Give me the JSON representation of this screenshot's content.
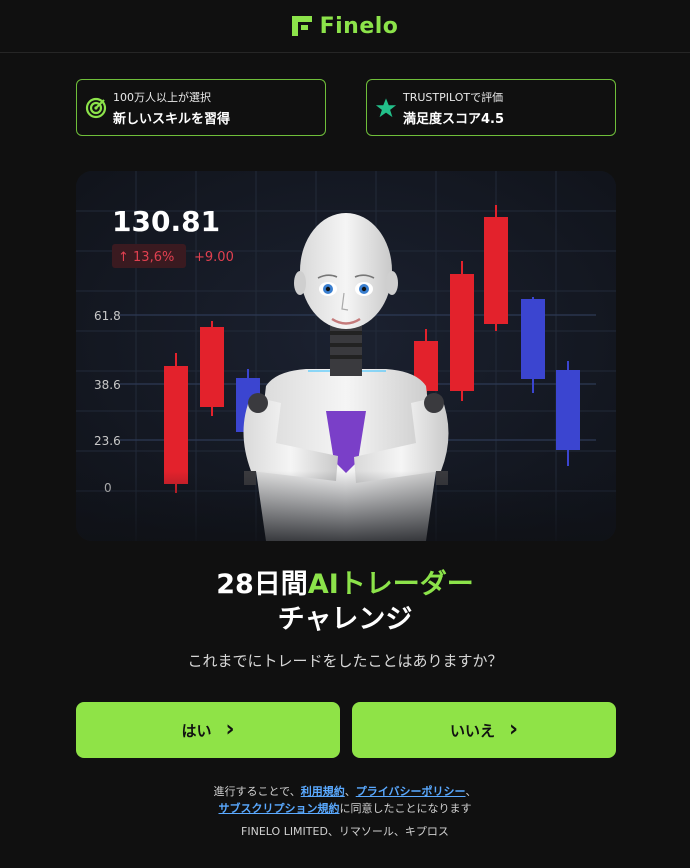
{
  "brand": {
    "name": "Finelo",
    "color": "#8ce34a"
  },
  "badges": [
    {
      "icon": "target-icon",
      "small": "100万人以上が選択",
      "big": "新しいスキルを習得"
    },
    {
      "icon": "star-icon",
      "small": "TRUSTPILOTで評価",
      "big": "満足度スコア4.5"
    }
  ],
  "hero": {
    "price": "130.81",
    "change_pct": "↑ 13,6%",
    "change_abs": "+9.00",
    "y_ticks": [
      "61.8",
      "38.6",
      "23.6",
      "0"
    ]
  },
  "title": {
    "line1_plain": "28日間",
    "line1_accent": "AIトレーダー",
    "line2": "チャレンジ"
  },
  "question": "これまでにトレードをしたことはありますか？",
  "buttons": {
    "yes": "はい",
    "no": "いいえ",
    "chevron": "›"
  },
  "legal": {
    "prefix": "進行することで、",
    "terms": "利用規約",
    "sep": "、",
    "privacy": "プライバシーポリシー",
    "sep2": "、",
    "subscription": "サブスクリプション規約",
    "suffix": "に同意したことになります"
  },
  "company": "FINELO LIMITED、リマソール、キプロス"
}
